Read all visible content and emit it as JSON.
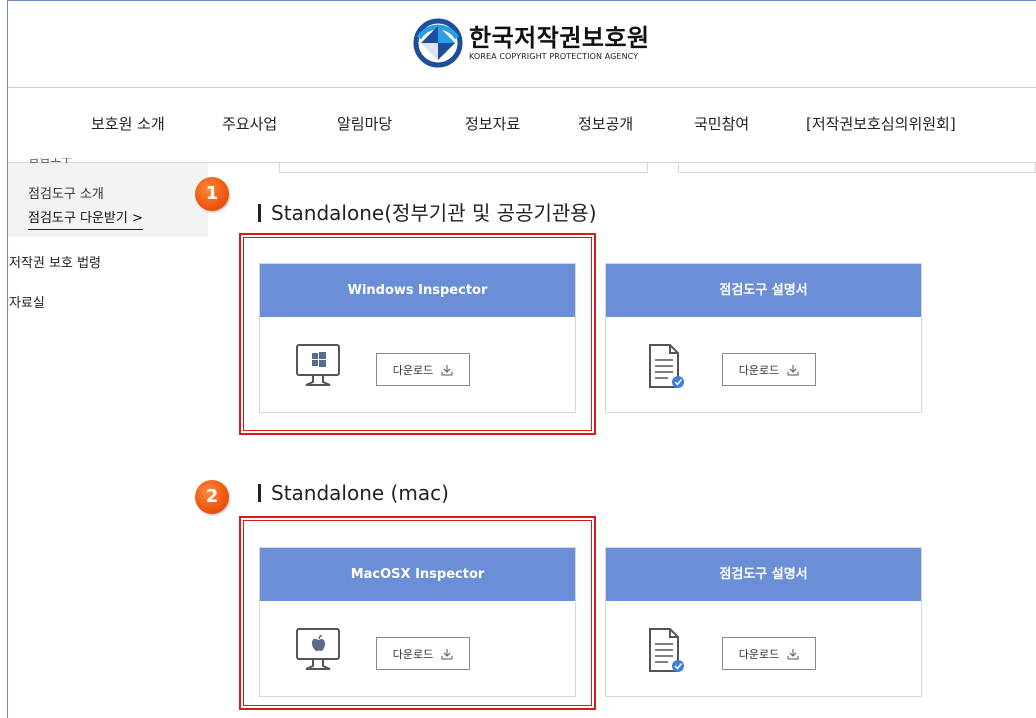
{
  "header": {
    "logo_kr": "한국저작권보호원",
    "logo_en": "KOREA COPYRIGHT PROTECTION AGENCY",
    "brand_color": "#1b4e9c"
  },
  "nav": {
    "items": [
      {
        "label": "보호원 소개"
      },
      {
        "label": "주요사업"
      },
      {
        "label": "알림마당"
      },
      {
        "label": "정보자료"
      },
      {
        "label": "정보공개"
      },
      {
        "label": "국민참여"
      },
      {
        "label": "[저작권보호심의위원회]"
      }
    ]
  },
  "sidebar": {
    "clipped_label": "점검도구",
    "sub_items": [
      {
        "label": "점검도구 소개"
      },
      {
        "label": "점검도구 다운받기  >"
      }
    ],
    "main_items": [
      {
        "label": "저작권 보호 법령"
      },
      {
        "label": "자료실"
      }
    ]
  },
  "sections": [
    {
      "badge": "1",
      "title": "Standalone(정부기관 및 공공기관용)",
      "cards": [
        {
          "title": "Windows Inspector",
          "icon": "windows-monitor-icon",
          "button": "다운로드"
        },
        {
          "title": "점검도구 설명서",
          "icon": "document-check-icon",
          "button": "다운로드"
        }
      ]
    },
    {
      "badge": "2",
      "title": "Standalone (mac)",
      "cards": [
        {
          "title": "MacOSX Inspector",
          "icon": "apple-monitor-icon",
          "button": "다운로드"
        },
        {
          "title": "점검도구 설명서",
          "icon": "document-check-icon",
          "button": "다운로드"
        }
      ]
    }
  ],
  "colors": {
    "card_header": "#6b8fd6",
    "highlight_border": "#d81a1a",
    "badge": "#f05a10"
  }
}
